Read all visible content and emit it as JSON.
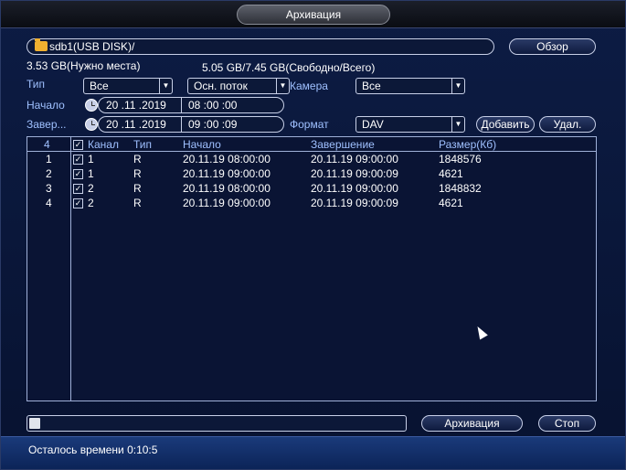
{
  "title": "Архивация",
  "path": {
    "value": "sdb1(USB DISK)/"
  },
  "browse_label": "Обзор",
  "storage": {
    "required": "3.53 GB(Нужно места)",
    "free_total": "5.05 GB/7.45 GB(Свободно/Всего)"
  },
  "filters": {
    "type_label": "Тип",
    "type_value": "Все",
    "stream_value": "Осн. поток",
    "camera_label": "Камера",
    "camera_value": "Все",
    "start_label": "Начало",
    "start_date": "20 .11 .2019",
    "start_time": "08 :00 :00",
    "end_label": "Завер...",
    "end_date": "20 .11 .2019",
    "end_time": "09 :00 :09",
    "format_label": "Формат",
    "format_value": "DAV",
    "add_label": "Добавить",
    "delete_label": "Удал."
  },
  "table": {
    "count": "4",
    "headers": [
      "Канал",
      "Тип",
      "Начало",
      "Завершение",
      "Размер(Кб)"
    ],
    "rows": [
      {
        "num": "1",
        "channel": "1",
        "type": "R",
        "start": "20.11.19 08:00:00",
        "end": "20.11.19 09:00:00",
        "size": "1848576"
      },
      {
        "num": "2",
        "channel": "1",
        "type": "R",
        "start": "20.11.19 09:00:00",
        "end": "20.11.19 09:00:09",
        "size": "4621"
      },
      {
        "num": "3",
        "channel": "2",
        "type": "R",
        "start": "20.11.19 08:00:00",
        "end": "20.11.19 09:00:00",
        "size": "1848832"
      },
      {
        "num": "4",
        "channel": "2",
        "type": "R",
        "start": "20.11.19 09:00:00",
        "end": "20.11.19 09:00:09",
        "size": "4621"
      }
    ]
  },
  "progress": {
    "fraction": 0.03
  },
  "archive_label": "Архивация",
  "stop_label": "Стоп",
  "status": {
    "remaining": "Осталось времени 0:10:5"
  },
  "colors": {
    "background": "#0d1c44",
    "accent_text": "#9fc0ff",
    "statusbar": "#1a3a7a"
  }
}
